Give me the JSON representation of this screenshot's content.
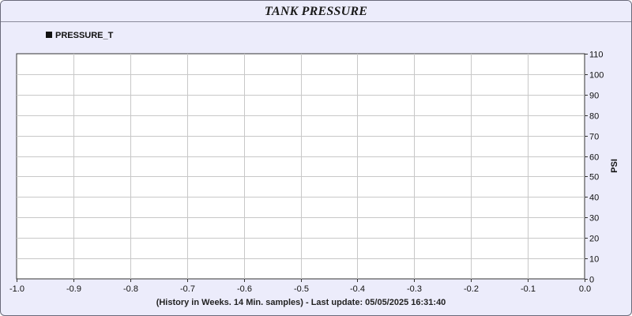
{
  "title": "TANK PRESSURE",
  "footer": "(History in Weeks. 14 Min. samples) - Last update: 05/05/2025 16:31:40",
  "colors": {
    "background": "#ececfb",
    "plot_area": "#ffffff",
    "grid": "#c8c8c8",
    "series": "#111111"
  },
  "chart_data": {
    "type": "line",
    "title": "TANK PRESSURE",
    "xlabel": "",
    "ylabel": "PSI",
    "xlim": [
      -1.0,
      0.0
    ],
    "ylim": [
      0,
      110
    ],
    "x_ticks": [
      -1.0,
      -0.9,
      -0.8,
      -0.7,
      -0.6,
      -0.5,
      -0.4,
      -0.3,
      -0.2,
      -0.1,
      0.0
    ],
    "x_tick_labels": [
      "-1.0",
      "-0.9",
      "-0.8",
      "-0.7",
      "-0.6",
      "-0.5",
      "-0.4",
      "-0.3",
      "-0.2",
      "-0.1",
      "0.0"
    ],
    "y_ticks": [
      0,
      10,
      20,
      30,
      40,
      50,
      60,
      70,
      80,
      90,
      100,
      110
    ],
    "y_tick_labels": [
      "0",
      "10",
      "20",
      "30",
      "40",
      "50",
      "60",
      "70",
      "80",
      "90",
      "100",
      "110"
    ],
    "y_axis_side": "right",
    "grid": true,
    "legend_position": "top-left",
    "series": [
      {
        "name": "PRESSURE_T",
        "x": [],
        "y": []
      }
    ]
  }
}
